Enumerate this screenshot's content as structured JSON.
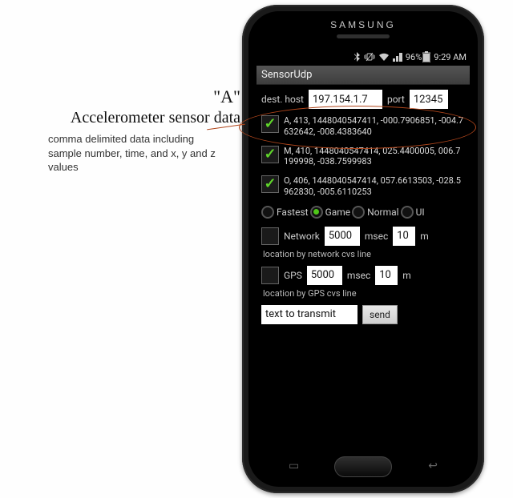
{
  "annotation": {
    "a": "\"A\"",
    "title": "Accelerometer sensor data",
    "sub": "comma delimited data including sample number, time, and x, y and z values"
  },
  "phone": {
    "brand": "SAMSUNG",
    "status": {
      "battery_pct": "96%",
      "time": "9:29 AM"
    },
    "app_title": "SensorUdp",
    "dest": {
      "host_label": "dest. host",
      "host_value": "197.154.1.7",
      "port_label": "port",
      "port_value": "12345"
    },
    "sensors": [
      {
        "checked": true,
        "text": "A, 413, 1448040547411, -000.7906851, -004.7632642, -008.4383640"
      },
      {
        "checked": true,
        "text": "M, 410, 1448040547414, 025.4400005, 006.7199998, -038.7599983"
      },
      {
        "checked": true,
        "text": "O, 406, 1448040547414, 057.6613503, -028.5962830, -005.6110253"
      }
    ],
    "rate": {
      "options": [
        "Fastest",
        "Game",
        "Normal",
        "UI"
      ],
      "selected": "Game"
    },
    "network": {
      "label": "Network",
      "checked": false,
      "interval": "5000",
      "interval_unit": "msec",
      "dist": "10",
      "dist_unit": "m",
      "hint": "location by network cvs line"
    },
    "gps": {
      "label": "GPS",
      "checked": false,
      "interval": "5000",
      "interval_unit": "msec",
      "dist": "10",
      "dist_unit": "m",
      "hint": "location by GPS cvs line"
    },
    "tx": {
      "placeholder": "text to transmit",
      "send_label": "send"
    }
  }
}
